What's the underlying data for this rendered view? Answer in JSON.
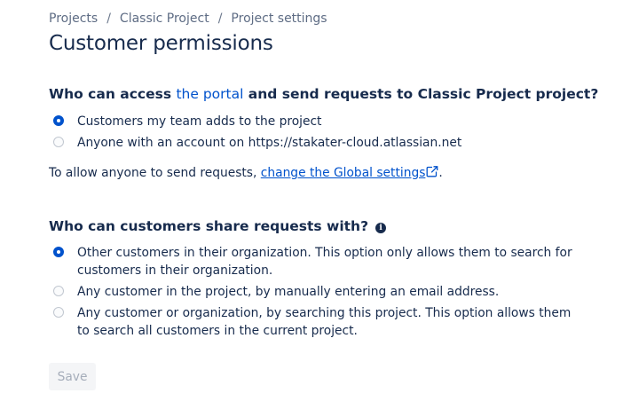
{
  "breadcrumb": {
    "items": [
      "Projects",
      "Classic Project",
      "Project settings"
    ],
    "separator": "/"
  },
  "page": {
    "title": "Customer permissions"
  },
  "access_section": {
    "heading_before": "Who can access ",
    "heading_link": "the portal",
    "heading_after": " and send requests to Classic Project project?",
    "options": [
      {
        "label": "Customers my team adds to the project",
        "selected": true
      },
      {
        "label": "Anyone with an account on https://stakater-cloud.atlassian.net",
        "selected": false
      }
    ],
    "note_text": "To allow anyone to send requests, ",
    "note_link": "change the Global settings",
    "note_link_icon": "external-link-icon",
    "note_end": "."
  },
  "share_section": {
    "heading": "Who can customers share requests with?",
    "info_icon": "info-icon",
    "info_glyph": "i",
    "options": [
      {
        "label": "Other customers in their organization. This option only allows them to search for customers in their organization.",
        "selected": true
      },
      {
        "label": "Any customer in the project, by manually entering an email address.",
        "selected": false
      },
      {
        "label": "Any customer or organization, by searching this project. This option allows them to search all customers in the current project.",
        "selected": false
      }
    ]
  },
  "actions": {
    "save_label": "Save",
    "save_disabled": true
  },
  "colors": {
    "text": "#172b4d",
    "link": "#0052cc",
    "muted": "#5e6c84",
    "radio_checked": "#0052cc",
    "button_disabled_bg": "#f4f5f7",
    "button_disabled_text": "#a5adba"
  }
}
